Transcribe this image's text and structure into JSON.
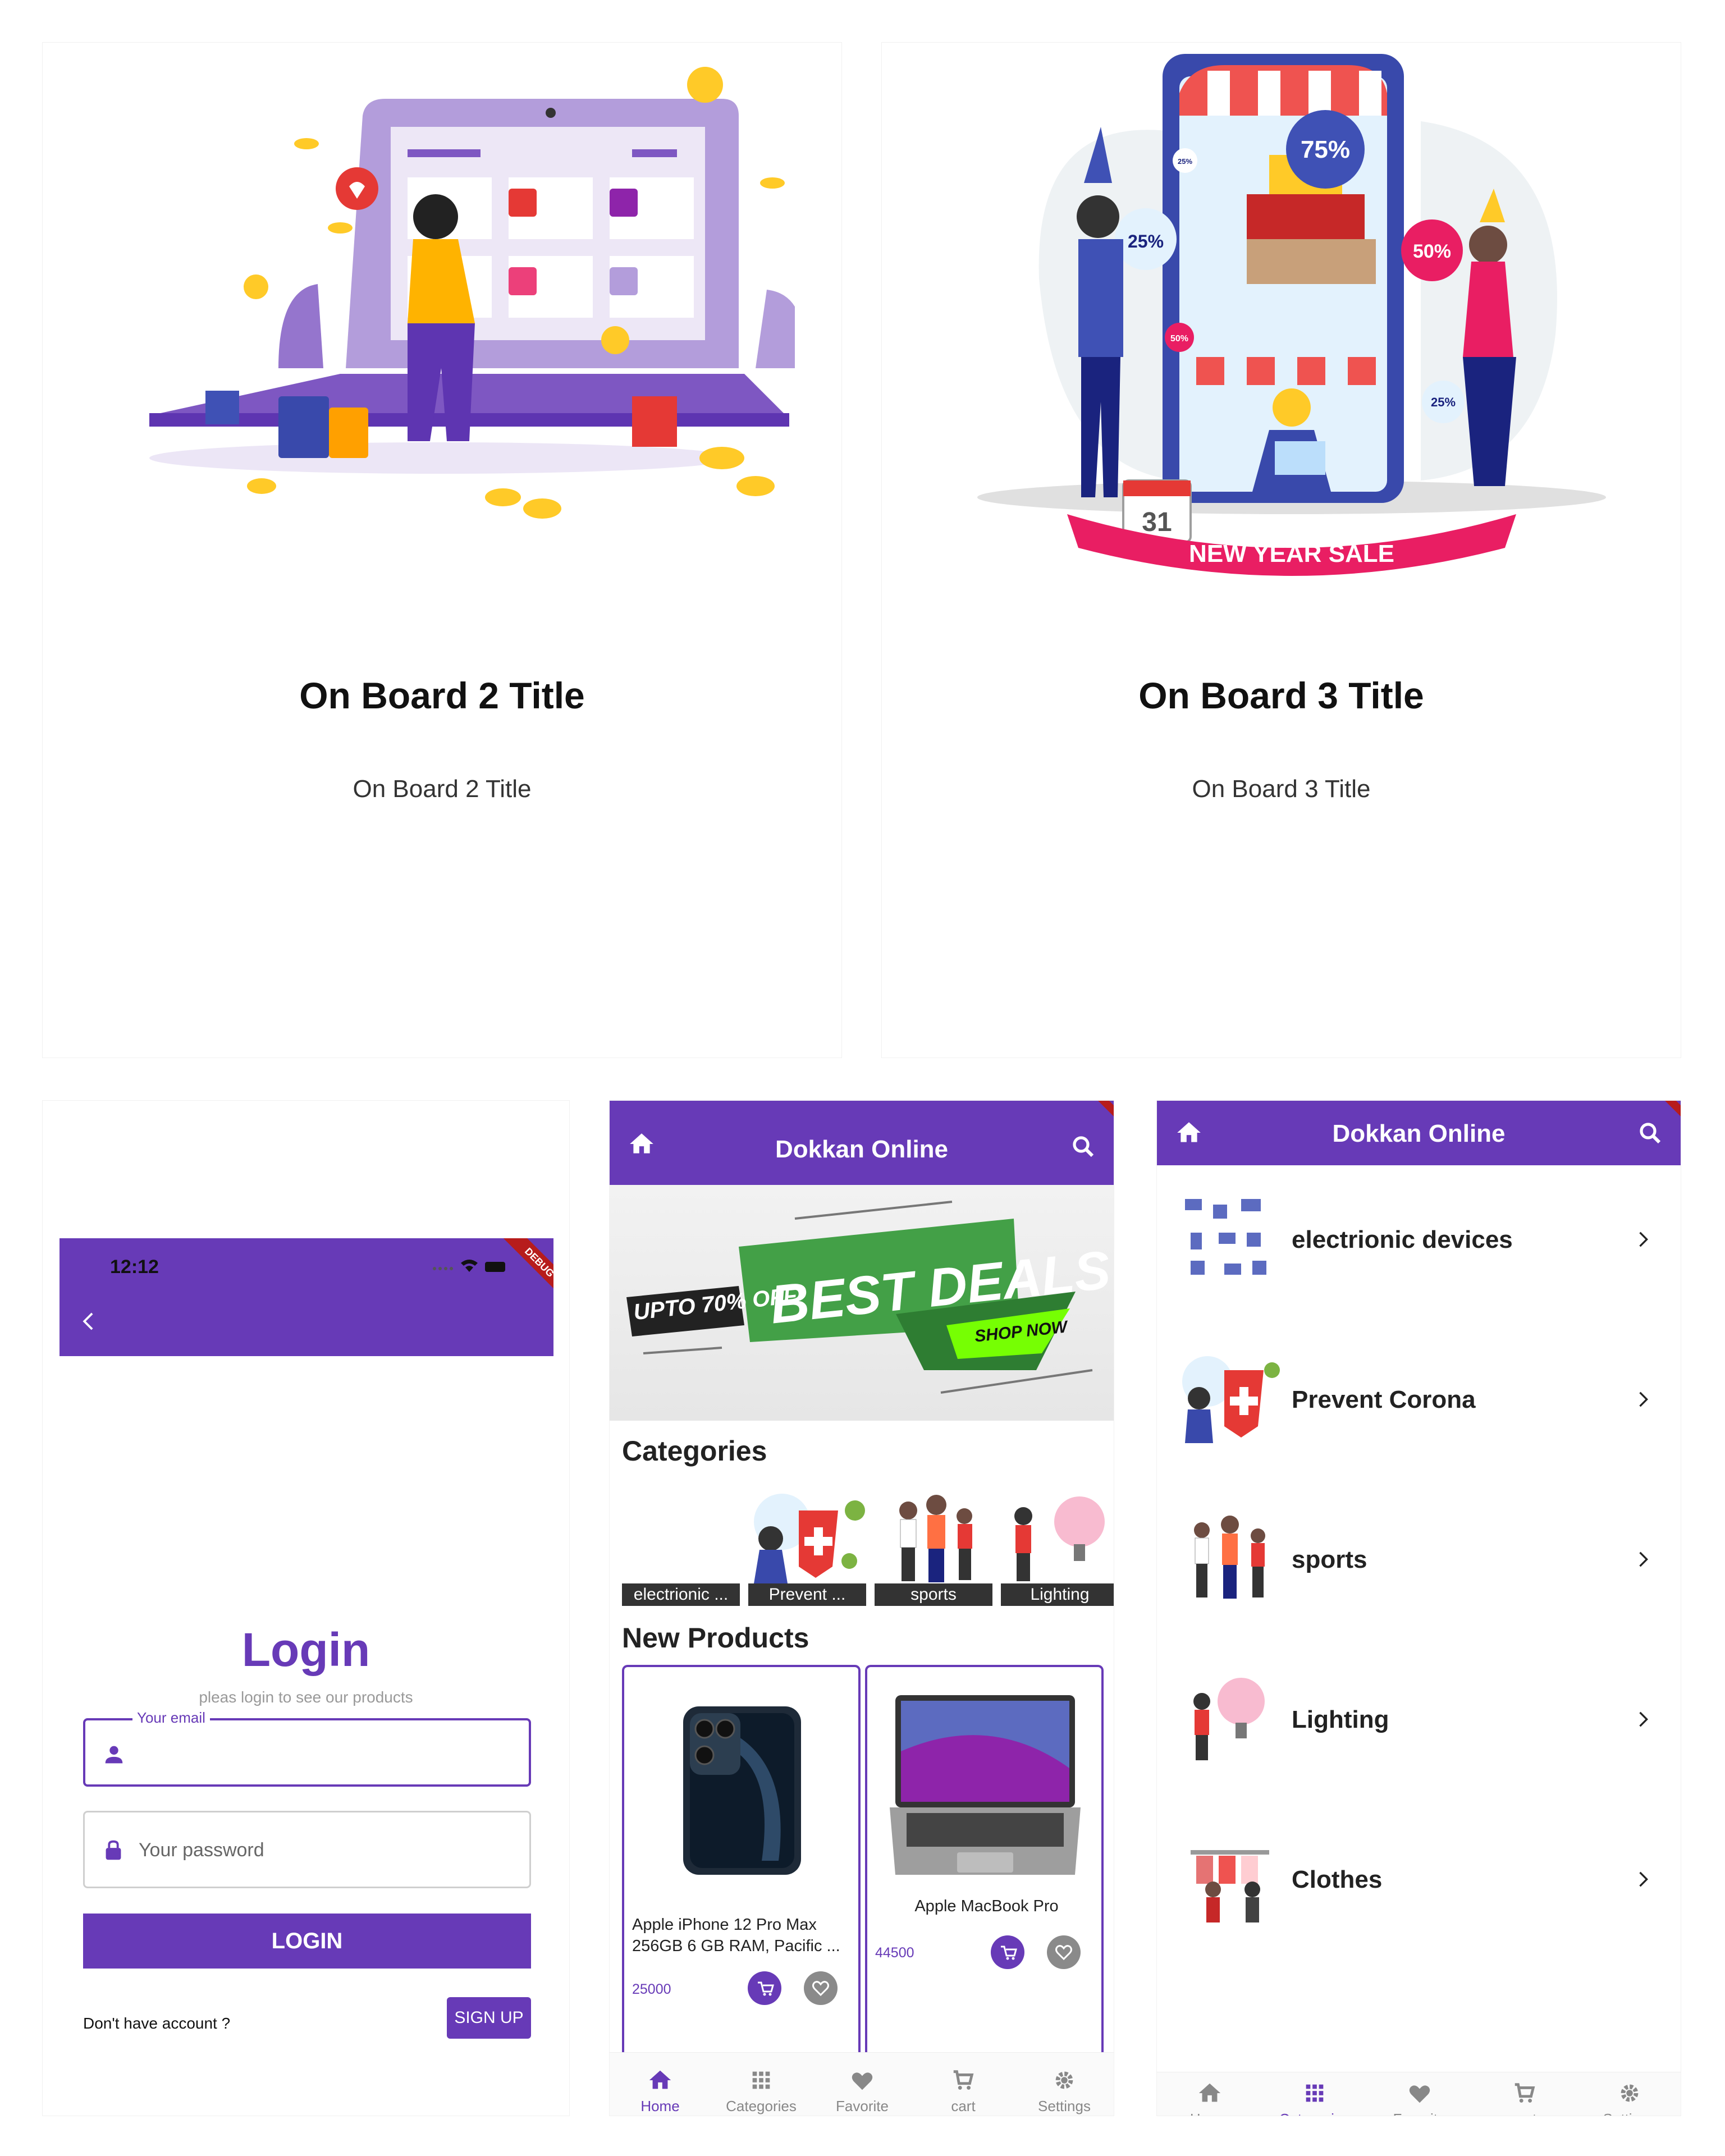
{
  "onboard": [
    {
      "title": "On Board 2 Title",
      "subtitle": "On Board 2 Title"
    },
    {
      "title": "On Board 3 Title",
      "subtitle": "On Board 3 Title",
      "banner": "NEW YEAR SALE",
      "badges": [
        "75%",
        "25%",
        "50%",
        "50%",
        "25%",
        "25%"
      ],
      "calendar_day": "31"
    }
  ],
  "login": {
    "status_time": "12:12",
    "debug": "DEBUG",
    "title": "Login",
    "subtitle": "pleas login to see our products",
    "email_label": "Your email",
    "password_placeholder": "Your password",
    "login_button": "LOGIN",
    "no_account": "Don't have account ?",
    "signup_button": "SIGN UP"
  },
  "home": {
    "app_title": "Dokkan Online",
    "banner": {
      "upto": "UPTO 70% OFF",
      "headline": "BEST DEALS",
      "cta": "SHOP NOW"
    },
    "categories_heading": "Categories",
    "categories": [
      "electrionic ...",
      "Prevent ...",
      "sports",
      "Lighting"
    ],
    "new_products_heading": "New Products",
    "products": [
      {
        "name": "Apple iPhone 12 Pro Max 256GB 6 GB RAM, Pacific ...",
        "price": "25000"
      },
      {
        "name": "Apple MacBook Pro",
        "price": "44500"
      }
    ],
    "nav": [
      "Home",
      "Categories",
      "Favorite",
      "cart",
      "Settings"
    ]
  },
  "categories_screen": {
    "app_title": "Dokkan Online",
    "items": [
      "electrionic devices",
      "Prevent Corona",
      "sports",
      "Lighting",
      "Clothes"
    ],
    "nav": [
      "Home",
      "Categories",
      "Favorite",
      "cart",
      "Settings"
    ]
  },
  "colors": {
    "primary": "#673AB7",
    "grey": "#8a8a8a",
    "debug": "#b71c1c"
  }
}
